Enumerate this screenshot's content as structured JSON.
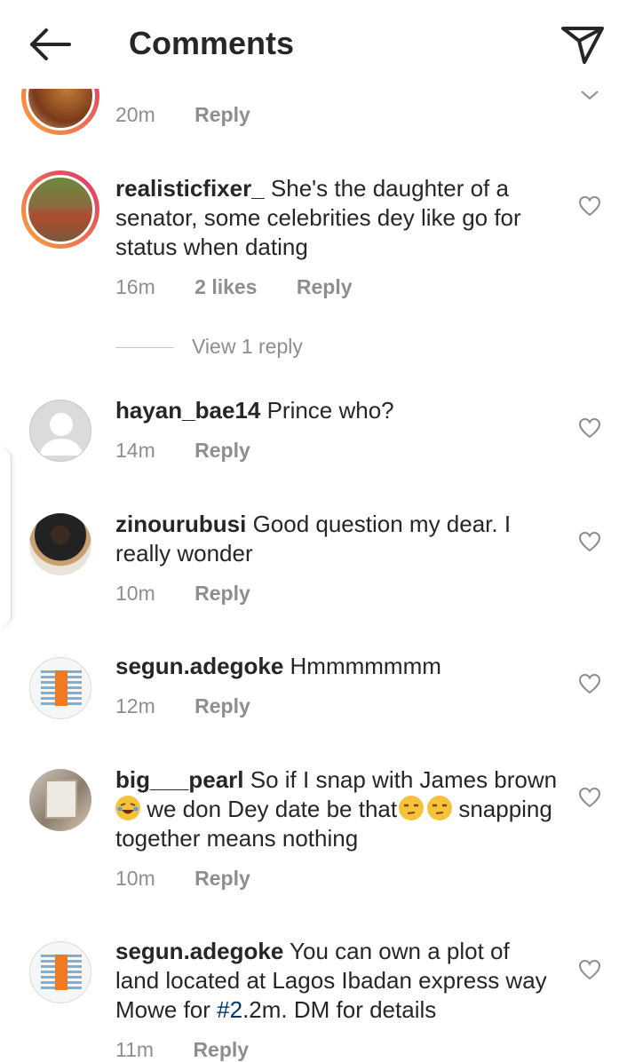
{
  "header": {
    "title": "Comments"
  },
  "first_comment": {
    "time": "20m",
    "reply": "Reply"
  },
  "comments": [
    {
      "user": "realisticfixer_",
      "text": "She's the daughter of a senator, some celebrities dey like go for status when dating",
      "time": "16m",
      "likes": "2 likes",
      "reply": "Reply"
    },
    {
      "user": "hayan_bae14",
      "text": "Prince who?",
      "time": "14m",
      "reply": "Reply"
    },
    {
      "user": "zinourubusi",
      "text": "Good question my dear. I really wonder",
      "time": "10m",
      "reply": "Reply"
    },
    {
      "user": "segun.adegoke",
      "text": "Hmmmmmmm",
      "time": "12m",
      "reply": "Reply"
    },
    {
      "user": "big___pearl",
      "text_a": "So if I snap with James brown",
      "text_b": " we don Dey date be that",
      "text_c": " snapping together means nothing",
      "time": "10m",
      "reply": "Reply"
    },
    {
      "user": "segun.adegoke",
      "text_a": "You can own a plot of land located at Lagos Ibadan express way Mowe for ",
      "hashtag": "#2",
      "text_b": ".2m. DM for details",
      "time": "11m",
      "reply": "Reply"
    }
  ],
  "view_replies": "View 1 reply",
  "icons": {
    "back": "arrow-left-icon",
    "send": "paper-plane-icon",
    "like": "heart-outline-icon"
  }
}
